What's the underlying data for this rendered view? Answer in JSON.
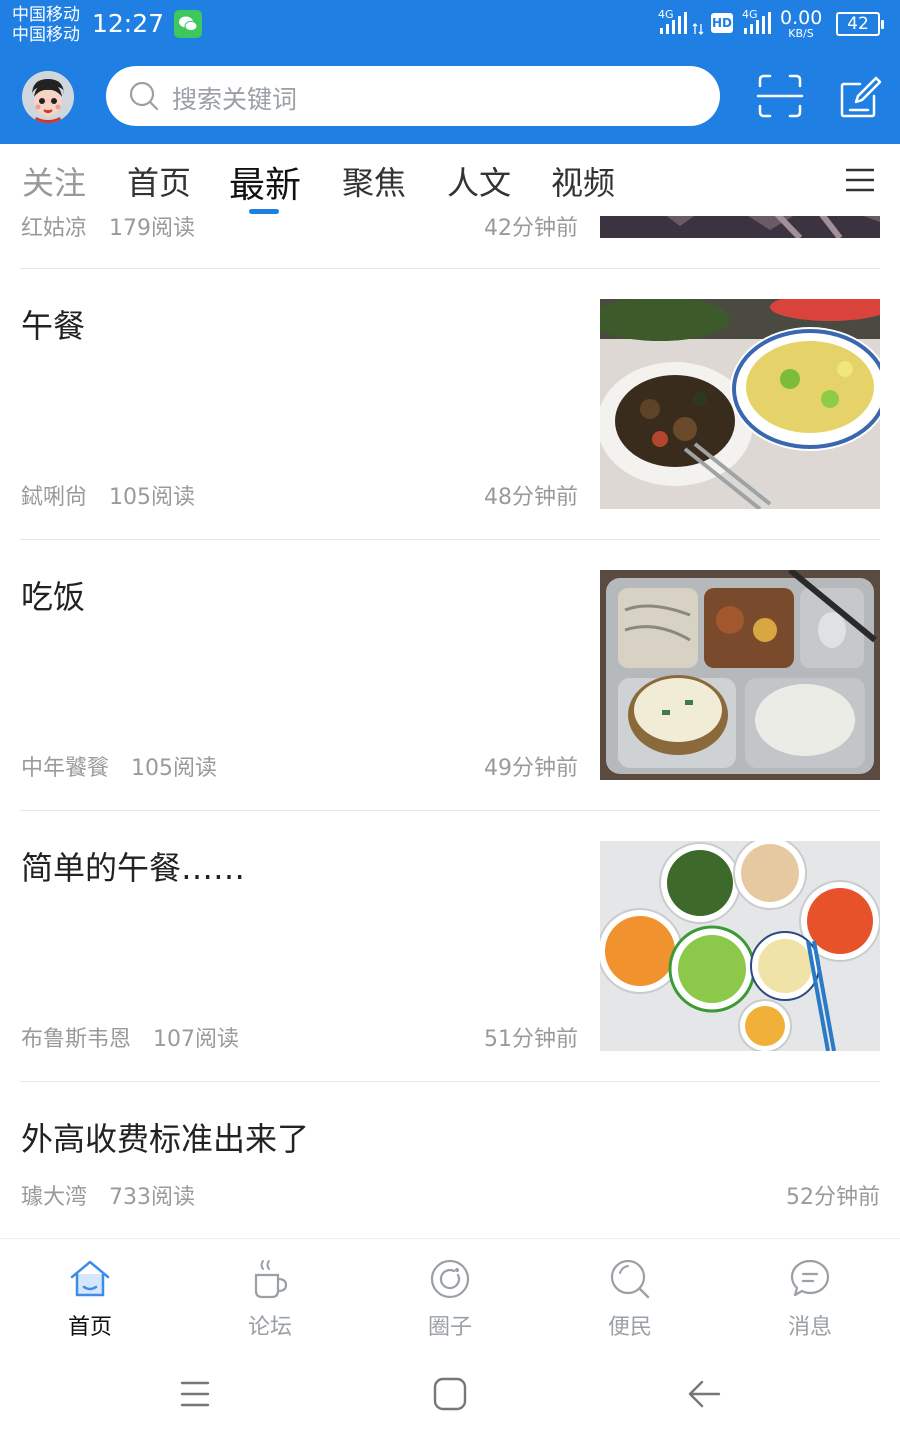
{
  "status_bar": {
    "carrier_1": "中国移动",
    "carrier_2": "中国移动",
    "time": "12:27",
    "network_1": "4G",
    "network_2": "4G",
    "hd_label": "HD",
    "speed_value": "0.00",
    "speed_unit": "KB/S",
    "battery": "42"
  },
  "header": {
    "search_placeholder": "搜索关键词",
    "icons": [
      "avatar",
      "search-icon",
      "scan-icon",
      "compose-icon"
    ]
  },
  "tabs": [
    {
      "label": "关注",
      "state": "partial"
    },
    {
      "label": "首页",
      "state": "normal"
    },
    {
      "label": "最新",
      "state": "active"
    },
    {
      "label": "聚焦",
      "state": "normal"
    },
    {
      "label": "人文",
      "state": "normal"
    },
    {
      "label": "视频",
      "state": "normal"
    }
  ],
  "feed": {
    "partial_item": {
      "author": "红姑凉",
      "reads": "179阅读",
      "time": "42分钟前"
    },
    "items": [
      {
        "title": "午餐",
        "author": "鋱唎尙",
        "reads": "105阅读",
        "time": "48分钟前",
        "image": "lunch-dishes"
      },
      {
        "title": "吃饭",
        "author": "中年饕餮",
        "reads": "105阅读",
        "time": "49分钟前",
        "image": "canteen-tray"
      },
      {
        "title": "简单的午餐……",
        "author": "布鲁斯韦恩",
        "reads": "107阅读",
        "time": "51分钟前",
        "image": "home-meal-table"
      },
      {
        "title": "外高收费标准出来了",
        "author": "璩大湾",
        "reads": "733阅读",
        "time": "52分钟前",
        "image": null
      }
    ]
  },
  "bottom_nav": [
    {
      "label": "首页",
      "icon": "home-icon",
      "active": true
    },
    {
      "label": "论坛",
      "icon": "coffee-cup-icon",
      "active": false
    },
    {
      "label": "圈子",
      "icon": "circle-icon",
      "active": false
    },
    {
      "label": "便民",
      "icon": "search-icon",
      "active": false
    },
    {
      "label": "消息",
      "icon": "chat-bubble-icon",
      "active": false
    }
  ],
  "colors": {
    "brand_blue": "#1f7fe3",
    "text_primary": "#222222",
    "text_secondary": "#9a9a9a",
    "divider": "#e6e6e6"
  }
}
